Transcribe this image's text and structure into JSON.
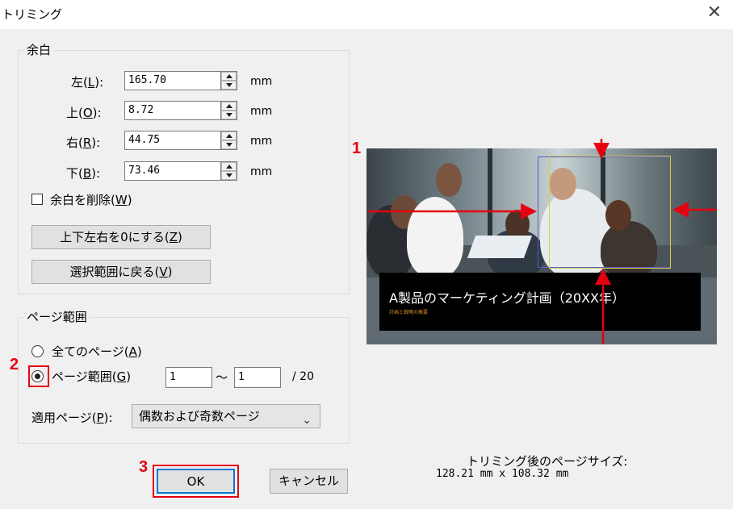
{
  "window": {
    "title": "トリミング",
    "close_glyph": "✕"
  },
  "margins": {
    "group_label": "余白",
    "fields": [
      {
        "label": "左(",
        "key": "L",
        "label_end": "):",
        "value": "165.70",
        "unit": "mm"
      },
      {
        "label": "上(",
        "key": "O",
        "label_end": "):",
        "value": "8.72",
        "unit": "mm"
      },
      {
        "label": "右(",
        "key": "R",
        "label_end": "):",
        "value": "44.75",
        "unit": "mm"
      },
      {
        "label": "下(",
        "key": "B",
        "label_end": "):",
        "value": "73.46",
        "unit": "mm"
      }
    ],
    "remove_margin": {
      "label": "余白を削除(",
      "key": "W",
      "label_end": ")",
      "checked": false
    },
    "zero_button": {
      "label": "上下左右を0にする(",
      "key": "Z",
      "label_end": ")"
    },
    "restore_button": {
      "label": "選択範囲に戻る(",
      "key": "V",
      "label_end": ")"
    }
  },
  "page_range": {
    "group_label": "ページ範囲",
    "all_pages": {
      "label": "全てのページ(",
      "key": "A",
      "label_end": ")",
      "selected": false
    },
    "range": {
      "label": "ページ範囲(",
      "key": "G",
      "label_end": ")",
      "selected": true
    },
    "from": "1",
    "tilde": "〜",
    "to": "1",
    "total": "/ 20",
    "apply_label": {
      "label": "適用ページ(",
      "key": "P",
      "label_end": "):"
    },
    "apply_value": "偶数および奇数ページ"
  },
  "preview": {
    "caption_title": "A製品のマーケティング計画（20XX年）",
    "caption_sub": "計画と戦略の概要"
  },
  "result": {
    "size_label": "トリミング後のページサイズ:",
    "size_value": "128.21 mm x 108.32 mm"
  },
  "buttons": {
    "ok": "OK",
    "cancel": "キャンセル"
  },
  "annotations": {
    "step1": "1",
    "step2": "2",
    "step3": "3"
  },
  "colors": {
    "annotation_red": "#e60012",
    "dialog_bg": "#f0f0f0"
  }
}
